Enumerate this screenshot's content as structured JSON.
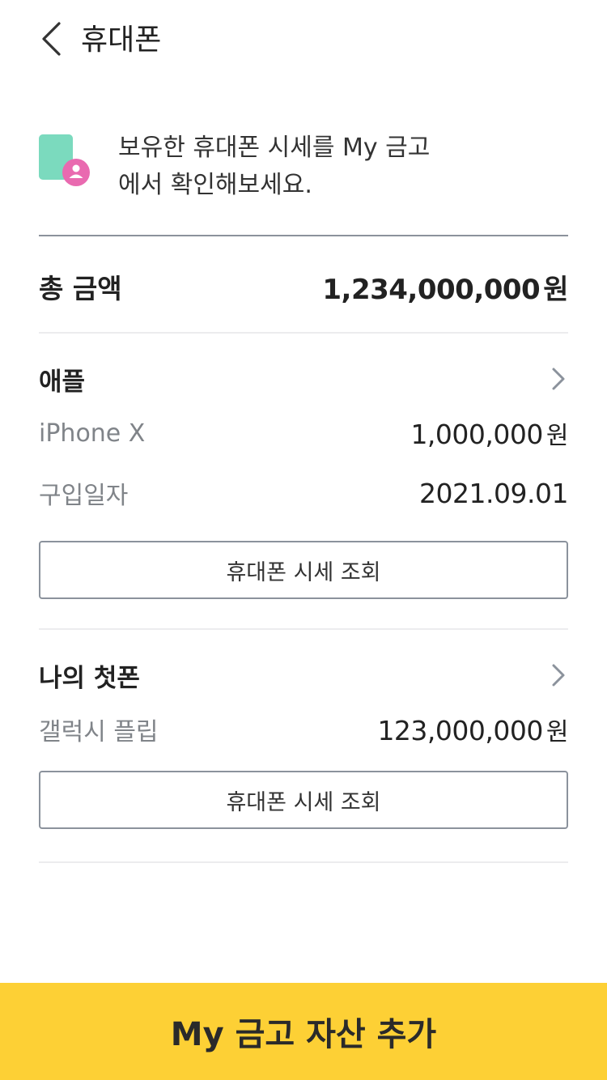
{
  "header": {
    "back_icon": "chevron-left-icon",
    "title": "휴대폰"
  },
  "intro": {
    "icon": "phone-person-icon",
    "line1": "보유한 휴대폰 시세를 My 금고",
    "line2": "에서 확인해보세요."
  },
  "total": {
    "label": "총 금액",
    "amount": "1,234,000,000",
    "unit": "원"
  },
  "phones": [
    {
      "name": "애플",
      "model": "iPhone X",
      "price": "1,000,000",
      "unit": "원",
      "date_label": "구입일자",
      "date": "2021.09.01",
      "button_label": "휴대폰 시세 조회"
    },
    {
      "name": "나의 첫폰",
      "model": "갤럭시 플립",
      "price": "123,000,000",
      "unit": "원",
      "button_label": "휴대폰 시세 조회"
    }
  ],
  "cta": {
    "label": "My 금고 자산 추가"
  },
  "colors": {
    "accent": "#fdd035",
    "divider": "#8b929c",
    "label": "#808489"
  }
}
